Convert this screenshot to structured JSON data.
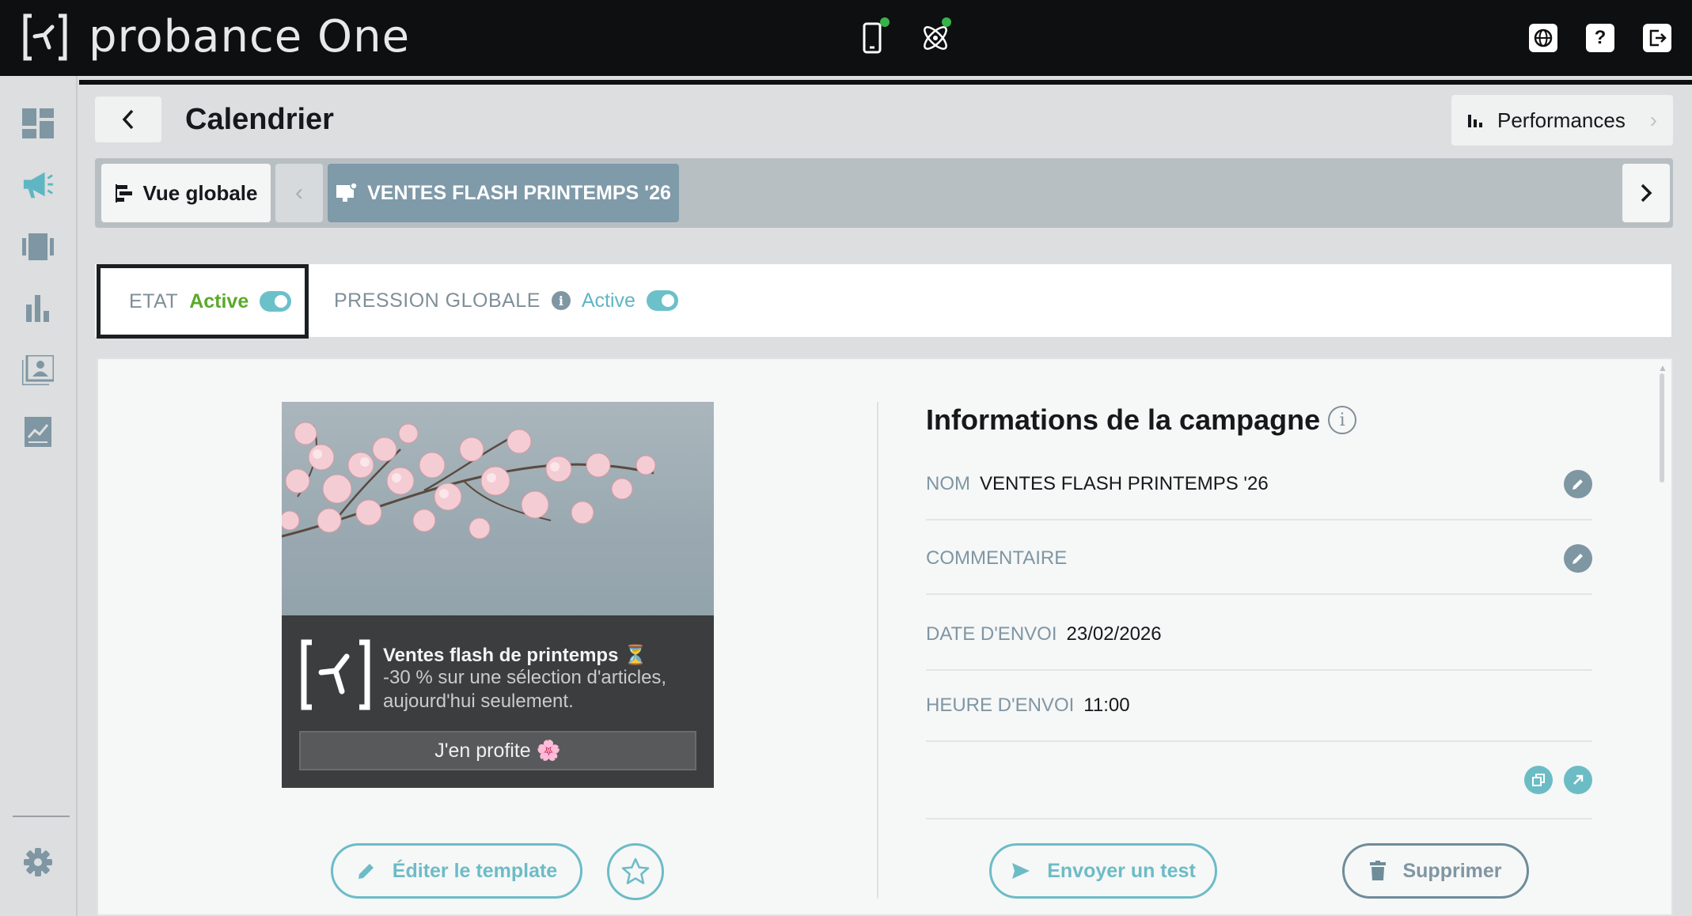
{
  "app": {
    "name": "probance One"
  },
  "header": {
    "title": "Calendrier",
    "performances_label": "Performances"
  },
  "breadcrumb": {
    "overview_label": "Vue globale",
    "campaign_label": "VENTES FLASH PRINTEMPS '26"
  },
  "status": {
    "etat_label": "ETAT",
    "etat_value": "Active",
    "pression_label": "PRESSION GLOBALE",
    "pression_value": "Active",
    "info_glyph": "i"
  },
  "preview": {
    "notif_title": "Ventes flash de printemps ⏳",
    "notif_body": "-30 % sur une sélection d'articles, aujourd'hui seulement.",
    "cta": "J'en profite 🌸"
  },
  "actions": {
    "edit_template": "Éditer le template",
    "send_test": "Envoyer un test",
    "delete": "Supprimer"
  },
  "campaign_info": {
    "title": "Informations de la campagne",
    "info_glyph": "i",
    "fields": [
      {
        "key": "NOM",
        "value": "VENTES FLASH PRINTEMPS '26"
      },
      {
        "key": "COMMENTAIRE",
        "value": ""
      },
      {
        "key": "DATE D'ENVOI",
        "value": "23/02/2026"
      },
      {
        "key": "HEURE D'ENVOI",
        "value": "11:00"
      }
    ]
  },
  "icons": {
    "topbar": [
      "mobile-icon",
      "atom-icon",
      "globe-icon",
      "help-icon",
      "logout-icon"
    ],
    "sidebar": [
      "dashboard-icon",
      "megaphone-icon",
      "carousel-icon",
      "bar-chart-icon",
      "contacts-icon",
      "report-icon",
      "settings-icon"
    ]
  },
  "colors": {
    "topbar": "#0d0f10",
    "accent_teal": "#6cbcc6",
    "active_green": "#5aaa2a",
    "status_dot": "#38b24a",
    "campaign_tab": "#7f9aa9"
  }
}
